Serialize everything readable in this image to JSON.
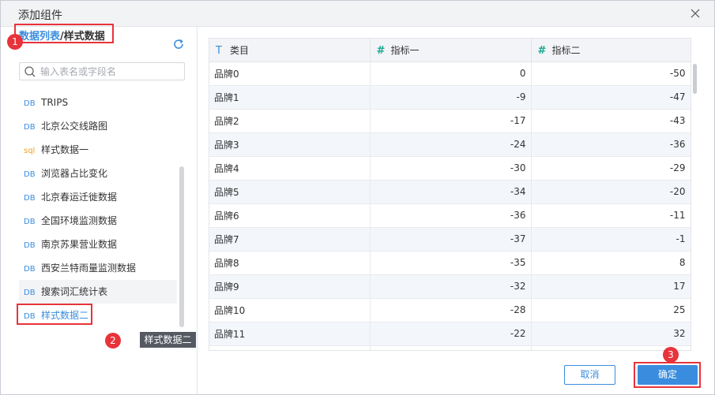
{
  "dialog": {
    "title": "添加组件"
  },
  "breadcrumb": {
    "root": "数据列表",
    "separator": "/",
    "current": "样式数据"
  },
  "search": {
    "placeholder": "输入表名或字段名"
  },
  "datasets": [
    {
      "type": "DB",
      "name": "TRIPS"
    },
    {
      "type": "DB",
      "name": "北京公交线路图"
    },
    {
      "type": "sql",
      "name": "样式数据一"
    },
    {
      "type": "DB",
      "name": "浏览器占比变化"
    },
    {
      "type": "DB",
      "name": "北京春运迁徙数据"
    },
    {
      "type": "DB",
      "name": "全国环境监测数据"
    },
    {
      "type": "DB",
      "name": "南京苏果营业数据"
    },
    {
      "type": "DB",
      "name": "西安兰特雨量监测数据"
    },
    {
      "type": "DB",
      "name": "搜索词汇统计表"
    },
    {
      "type": "DB",
      "name": "样式数据二"
    }
  ],
  "tooltip": "样式数据二",
  "table": {
    "columns": [
      {
        "icon": "T",
        "label": "类目"
      },
      {
        "icon": "#",
        "label": "指标一"
      },
      {
        "icon": "#",
        "label": "指标二"
      }
    ],
    "rows": [
      [
        "品牌0",
        "0",
        "-50"
      ],
      [
        "品牌1",
        "-9",
        "-47"
      ],
      [
        "品牌2",
        "-17",
        "-43"
      ],
      [
        "品牌3",
        "-24",
        "-36"
      ],
      [
        "品牌4",
        "-30",
        "-29"
      ],
      [
        "品牌5",
        "-34",
        "-20"
      ],
      [
        "品牌6",
        "-36",
        "-11"
      ],
      [
        "品牌7",
        "-37",
        "-1"
      ],
      [
        "品牌8",
        "-35",
        "8"
      ],
      [
        "品牌9",
        "-32",
        "17"
      ],
      [
        "品牌10",
        "-28",
        "25"
      ],
      [
        "品牌11",
        "-22",
        "32"
      ],
      [
        "",
        "",
        ""
      ]
    ]
  },
  "buttons": {
    "cancel": "取消",
    "ok": "确定"
  },
  "annotations": [
    "1",
    "2",
    "3"
  ],
  "colors": {
    "accent": "#3a8dde",
    "highlight": "#e8333a",
    "sql_tag": "#f0a020",
    "number_icon": "#1aa890"
  }
}
